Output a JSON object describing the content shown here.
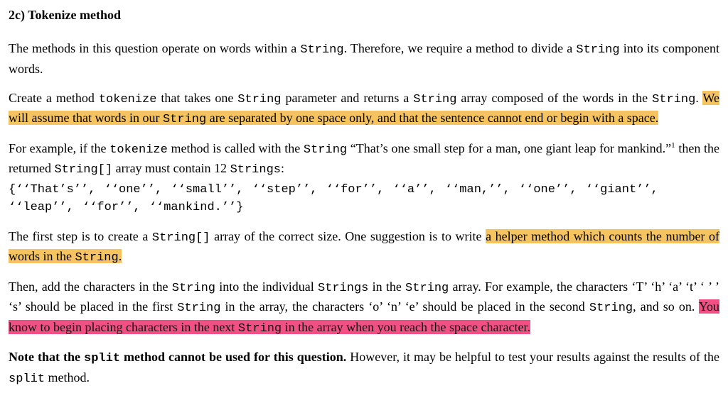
{
  "heading": "2c)  Tokenize method",
  "p1a": "The methods in this question operate on words within a ",
  "p1b": "String",
  "p1c": ".  Therefore, we require a method to divide a ",
  "p1d": "String",
  "p1e": " into its component words.",
  "p2a": "Create a method ",
  "p2b": "tokenize",
  "p2c": " that takes one ",
  "p2d": "String",
  "p2e": " parameter and returns a ",
  "p2f": "String",
  "p2g": " array composed of the words in the ",
  "p2h": "String",
  "p2i": ". ",
  "p2j": "We will assume that words in our ",
  "p2k": "String",
  "p2l": " are separated by one space only, and that the sentence cannot end or begin with a space.",
  "p3a": "For example, if the ",
  "p3b": "tokenize",
  "p3c": " method is called with the ",
  "p3d": "String",
  "p3e": " “That’s one small step for a man, one giant leap for mankind.”",
  "p3f": "1",
  "p3g": " then the returned ",
  "p3h": "String[]",
  "p3i": " array must contain 12 ",
  "p3j": "Strings",
  "p3k": ":",
  "array_text": "{‘‘That’s’’, ‘‘one’’, ‘‘small’’, ‘‘step’’, ‘‘for’’, ‘‘a’’, ‘‘man,’’, ‘‘one’’, ‘‘giant’’, ‘‘leap’’, ‘‘for’’, ‘‘mankind.’’}",
  "p4a": "The first step is to create a ",
  "p4b": "String[]",
  "p4c": " array of the correct size.  One suggestion is to write ",
  "p4d": "a helper method which counts the number of words in the ",
  "p4e": "String",
  "p4f": ".",
  "p5a": "Then, add the characters in the ",
  "p5b": "String",
  "p5c": " into the individual ",
  "p5d": "Strings",
  "p5e": " in the ",
  "p5f": "String",
  "p5g": " array. For example, the characters ‘T’ ‘h’ ‘a’ ‘t’ ‘ ’ ’ ‘s’ should be placed in the first ",
  "p5h": "String",
  "p5i": " in the array, the characters ‘o’ ‘n’ ‘e’ should be placed in the second ",
  "p5j": "String",
  "p5k": ", and so on. ",
  "p5l": "You know to begin placing characters in the next ",
  "p5m": "String",
  "p5n": " in the array when you reach the space character.",
  "p6a": "Note that the ",
  "p6b": "split",
  "p6c": " method cannot be used for this question.",
  "p6d": " However, it may be helpful to test your results against the results of the ",
  "p6e": "split",
  "p6f": " method."
}
